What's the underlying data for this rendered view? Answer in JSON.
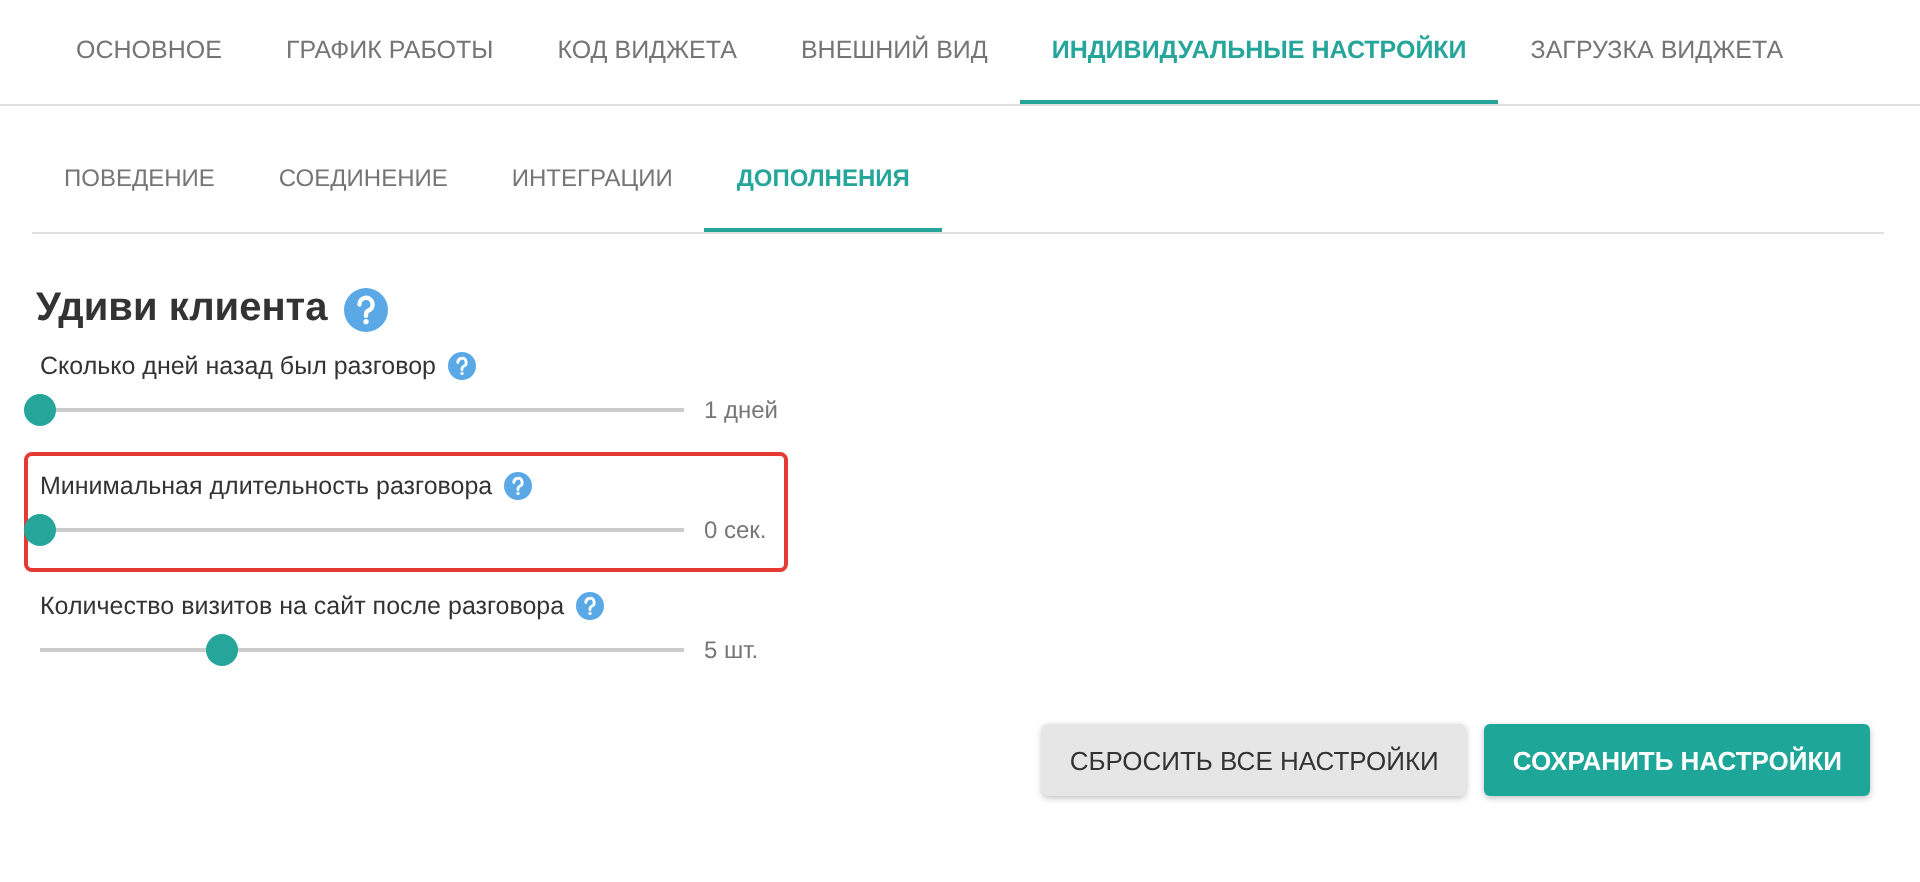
{
  "tabs": [
    {
      "label": "ОСНОВНОЕ",
      "selected": false
    },
    {
      "label": "ГРАФИК РАБОТЫ",
      "selected": false
    },
    {
      "label": "КОД ВИДЖЕТА",
      "selected": false
    },
    {
      "label": "ВНЕШНИЙ ВИД",
      "selected": false
    },
    {
      "label": "ИНДИВИДУАЛЬНЫЕ НАСТРОЙКИ",
      "selected": true
    },
    {
      "label": "ЗАГРУЗКА ВИДЖЕТА",
      "selected": false
    }
  ],
  "subtabs": [
    {
      "label": "ПОВЕДЕНИЕ",
      "selected": false
    },
    {
      "label": "СОЕДИНЕНИЕ",
      "selected": false
    },
    {
      "label": "ИНТЕГРАЦИИ",
      "selected": false
    },
    {
      "label": "ДОПОЛНЕНИЯ",
      "selected": true
    }
  ],
  "section": {
    "title": "Удиви клиента"
  },
  "sliders": [
    {
      "label": "Сколько дней назад был разговор",
      "level": 0,
      "reading": "1 дней",
      "highlighted": false
    },
    {
      "label": "Минимальная длительность разговора",
      "level": 0,
      "reading": "0 сек.",
      "highlighted": true
    },
    {
      "label": "Количество визитов на сайт после разговора",
      "level": 0.29,
      "reading": "5 шт.",
      "highlighted": false
    }
  ],
  "buttons": [
    {
      "label": "СБРОСИТЬ ВСЕ НАСТРОЙКИ",
      "kind": "secondary"
    },
    {
      "label": "СОХРАНИТЬ НАСТРОЙКИ",
      "kind": "primary"
    }
  ]
}
